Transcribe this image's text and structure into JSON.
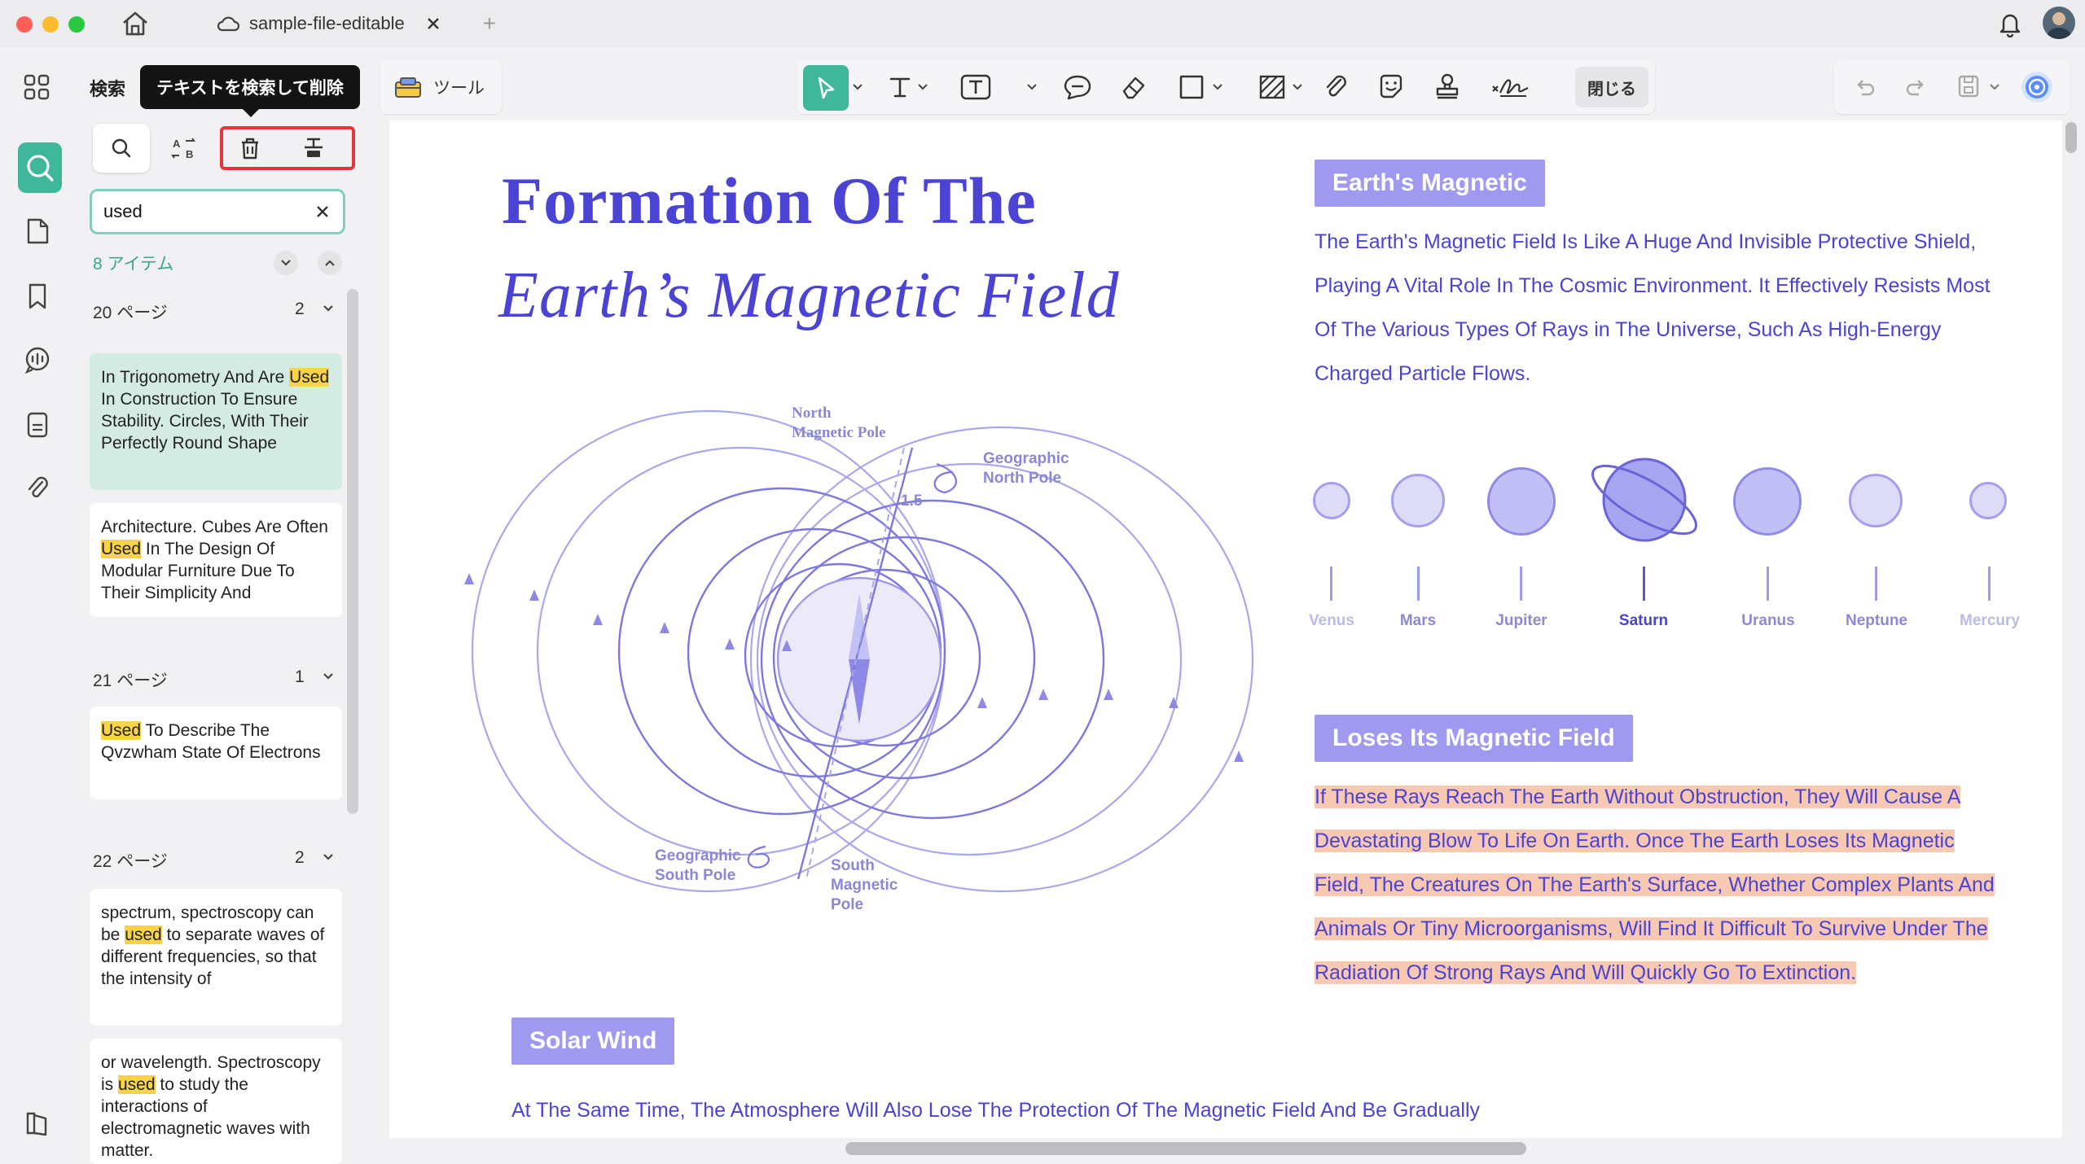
{
  "window": {
    "tab_title": "sample-file-editable",
    "new_tab": "+"
  },
  "search_panel": {
    "title": "検索",
    "tooltip": "テキストを検索して削除",
    "query": "used",
    "result_count": "8 アイテム",
    "groups": [
      {
        "page": "20 ページ",
        "count": "2",
        "results": [
          {
            "before": "In Trigonometry And Are ",
            "match": "Used",
            "after": " In Construction To Ensure Stability. Circles, With Their Perfectly Round Shape"
          },
          {
            "before": "Architecture. Cubes Are Often ",
            "match": "Used",
            "after": " In The Design Of Modular Furniture Due To Their Simplicity And"
          }
        ]
      },
      {
        "page": "21 ページ",
        "count": "1",
        "results": [
          {
            "before": "",
            "match": "Used",
            "after": " To Describe The Qvzwham State Of Electrons"
          }
        ]
      },
      {
        "page": "22 ページ",
        "count": "2",
        "results": [
          {
            "before": "spectrum, spectroscopy can be ",
            "match": "used",
            "after": " to separate waves of different frequencies, so that the intensity of"
          },
          {
            "before": "or wavelength. Spectroscopy is ",
            "match": "used",
            "after": " to study the interactions of electromagnetic waves with matter."
          }
        ]
      }
    ]
  },
  "toolbar": {
    "tools_label": "ツール",
    "close_label": "閉じる"
  },
  "document": {
    "title_line1": "Formation Of The",
    "title_line2": "Earth’s Magnetic Field",
    "section1": {
      "heading": "Earth's Magnetic",
      "lines": [
        "The Earth's Magnetic Field Is Like A Huge And Invisible Protective Shield,",
        "Playing A Vital Role In The Cosmic Environment. It Effectively Resists Most",
        "Of The Various Types Of Rays in The Universe, Such As High-Energy",
        "Charged Particle Flows."
      ]
    },
    "planets": [
      "Venus",
      "Mars",
      "Jupiter",
      "Saturn",
      "Uranus",
      "Neptune",
      "Mercury"
    ],
    "section2": {
      "heading": "Loses Its Magnetic Field",
      "lines": [
        "If These Rays Reach The Earth Without Obstruction, They Will Cause A",
        "Devastating Blow To Life On Earth. Once The Earth Loses Its Magnetic",
        "Field, The Creatures On The Earth's Surface, Whether Complex Plants And",
        "Animals Or Tiny Microorganisms, Will Find It Difficult To Survive Under The",
        "Radiation Of Strong Rays And Will Quickly Go To Extinction."
      ]
    },
    "section3": {
      "heading": "Solar Wind",
      "line": "At The Same Time, The Atmosphere Will Also Lose The Protection Of The Magnetic Field And Be Gradually"
    },
    "diagram": {
      "north_magnetic_pole": [
        "North",
        "Magnetic Pole"
      ],
      "geographic_north_pole": [
        "Geographic",
        "North Pole"
      ],
      "angle": "1.5",
      "geographic_south_pole": [
        "Geographic",
        "South Pole"
      ],
      "south_magnetic_pole": [
        "South",
        "Magnetic",
        "Pole"
      ]
    }
  },
  "colors": {
    "accent_green": "#3fb79b",
    "doc_blue": "#4a43d3",
    "tag_purple": "#9f9af0",
    "highlight_yellow": "#f8d347",
    "highlight_peach": "#f8c9b2",
    "annotation_red": "#e5353b"
  }
}
